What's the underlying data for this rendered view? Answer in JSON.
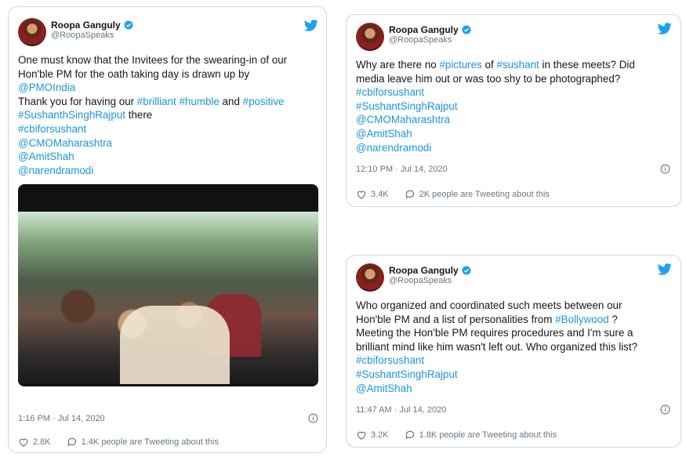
{
  "tweets": [
    {
      "author": {
        "name": "Roopa Ganguly",
        "handle": "@RoopaSpeaks"
      },
      "lines": [
        [
          {
            "t": "One must know that the Invitees for the swearing-in of our",
            "link": false
          }
        ],
        [
          {
            "t": "Hon'ble PM for the oath taking day is drawn up by",
            "link": false
          }
        ],
        [
          {
            "t": "@PMOIndia",
            "link": true
          }
        ],
        [
          {
            "t": "Thank you for having our ",
            "link": false
          },
          {
            "t": "#brilliant",
            "link": true
          },
          {
            "t": " ",
            "link": false
          },
          {
            "t": "#humble",
            "link": true
          },
          {
            "t": " and ",
            "link": false
          },
          {
            "t": "#positive",
            "link": true
          }
        ],
        [
          {
            "t": "#SushanthSinghRajput",
            "link": true
          },
          {
            "t": " there",
            "link": false
          }
        ],
        [
          {
            "t": "#cbiforsushant",
            "link": true
          }
        ],
        [
          {
            "t": "@CMOMaharashtra",
            "link": true
          }
        ],
        [
          {
            "t": "@AmitShah",
            "link": true
          }
        ],
        [
          {
            "t": "@narendramodi",
            "link": true
          }
        ]
      ],
      "time": "1:16 PM · Jul 14, 2020",
      "likes": "2.8K",
      "tweeting": "1.4K people are Tweeting about this"
    },
    {
      "author": {
        "name": "Roopa Ganguly",
        "handle": "@RoopaSpeaks"
      },
      "lines": [
        [
          {
            "t": "Why are there no ",
            "link": false
          },
          {
            "t": "#pictures",
            "link": true
          },
          {
            "t": " of ",
            "link": false
          },
          {
            "t": "#sushant",
            "link": true
          },
          {
            "t": " in these meets? Did",
            "link": false
          }
        ],
        [
          {
            "t": "media leave him out or was too shy to be photographed?",
            "link": false
          }
        ],
        [
          {
            "t": "#cbiforsushant",
            "link": true
          }
        ],
        [
          {
            "t": "#SushantSinghRajput",
            "link": true
          }
        ],
        [
          {
            "t": "@CMOMaharashtra",
            "link": true
          }
        ],
        [
          {
            "t": "@AmitShah",
            "link": true
          }
        ],
        [
          {
            "t": "@narendramodi",
            "link": true
          }
        ]
      ],
      "time": "12:10 PM · Jul 14, 2020",
      "likes": "3.4K",
      "tweeting": "2K people are Tweeting about this"
    },
    {
      "author": {
        "name": "Roopa Ganguly",
        "handle": "@RoopaSpeaks"
      },
      "lines": [
        [
          {
            "t": "Who organized and coordinated such meets between our",
            "link": false
          }
        ],
        [
          {
            "t": "Hon'ble PM and a list of personalities from ",
            "link": false
          },
          {
            "t": "#Bollywood",
            "link": true
          },
          {
            "t": " ?",
            "link": false
          }
        ],
        [
          {
            "t": "Meeting the Hon'ble PM requires procedures and I'm sure a",
            "link": false
          }
        ],
        [
          {
            "t": "brilliant mind like him wasn't left out. Who organized this list?",
            "link": false
          }
        ],
        [
          {
            "t": "#cbiforsushant",
            "link": true
          }
        ],
        [
          {
            "t": "#SushantSinghRajput",
            "link": true
          }
        ],
        [
          {
            "t": "@AmitShah",
            "link": true
          }
        ]
      ],
      "time": "11:47 AM · Jul 14, 2020",
      "likes": "3.2K",
      "tweeting": "1.8K people are Tweeting about this"
    }
  ],
  "colors": {
    "link": "#1b95e0",
    "text": "#14171a",
    "muted": "#657786",
    "border": "#cfd9de"
  }
}
